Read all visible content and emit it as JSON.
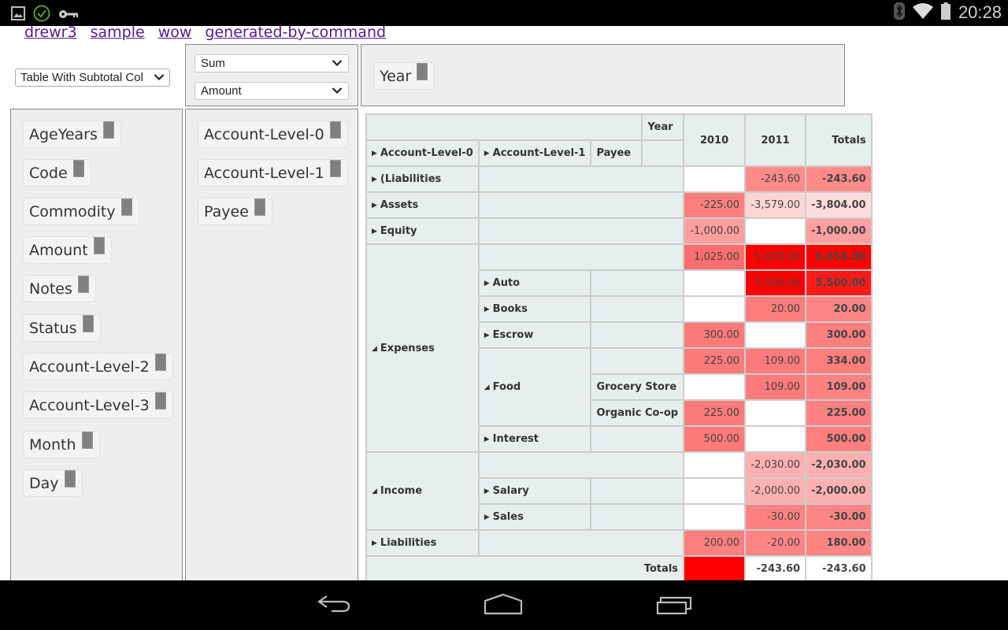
{
  "status_bar": {
    "left_icons": [
      "gallery-icon",
      "check-circle-icon",
      "key-icon"
    ],
    "right_icons": [
      "bluetooth-icon",
      "wifi-icon",
      "battery-icon"
    ],
    "time": "20:28"
  },
  "nav_links": [
    "drewr3",
    "sample",
    "wow",
    "generated-by-command"
  ],
  "renderer": {
    "selected": "Table With Subtotal Col"
  },
  "aggregator": {
    "function": "Sum",
    "attribute": "Amount"
  },
  "col_attrs": [
    "Year"
  ],
  "unused_attrs": [
    "AgeYears",
    "Code",
    "Commodity",
    "Amount",
    "Notes",
    "Status",
    "Account-Level-2",
    "Account-Level-3",
    "Month",
    "Day"
  ],
  "row_attrs": [
    "Account-Level-0",
    "Account-Level-1",
    "Payee"
  ],
  "table": {
    "col_attr_label": "Year",
    "row_headers": [
      "Account-Level-0",
      "Account-Level-1",
      "Payee"
    ],
    "col_keys": [
      "2010",
      "2011"
    ],
    "totals_label": "Totals",
    "rows": [
      {
        "l0": "(Liabilities",
        "l0_state": "collapsed",
        "l1": "",
        "payee": "",
        "v2010": "",
        "v2011": "-243.60",
        "total": "-243.60",
        "c2010": "#ffffff",
        "c2011": "#ff8a8a",
        "ctot": "#ff8a8a"
      },
      {
        "l0": "Assets",
        "l0_state": "collapsed",
        "l1": "",
        "payee": "",
        "v2010": "-225.00",
        "v2011": "-3,579.00",
        "total": "-3,804.00",
        "c2010": "#ff7f7f",
        "c2011": "#ffd6d6",
        "ctot": "#ffdcdc"
      },
      {
        "l0": "Equity",
        "l0_state": "collapsed",
        "l1": "",
        "payee": "",
        "v2010": "-1,000.00",
        "v2011": "",
        "total": "-1,000.00",
        "c2010": "#ff9e9e",
        "c2011": "#ffffff",
        "ctot": "#ffa0a0"
      },
      {
        "l0": "Expenses",
        "l0_state": "expanded",
        "l1": "",
        "payee": "",
        "v2010": "1,025.00",
        "v2011": "5,629.00",
        "total": "6,654.00",
        "c2010": "#ff6e6e",
        "c2011": "#ff0000",
        "ctot": "#ff0000"
      },
      {
        "l0": "Expenses",
        "l1": "Auto",
        "l1_state": "collapsed",
        "payee": "",
        "v2010": "",
        "v2011": "5,500.00",
        "total": "5,500.00",
        "c2010": "#ffffff",
        "c2011": "#ff0000",
        "ctot": "#ff1a1a"
      },
      {
        "l0": "Expenses",
        "l1": "Books",
        "l1_state": "collapsed",
        "payee": "",
        "v2010": "",
        "v2011": "20.00",
        "total": "20.00",
        "c2010": "#ffffff",
        "c2011": "#ff7c7c",
        "ctot": "#ff8585"
      },
      {
        "l0": "Expenses",
        "l1": "Escrow",
        "l1_state": "collapsed",
        "payee": "",
        "v2010": "300.00",
        "v2011": "",
        "total": "300.00",
        "c2010": "#ff7a7a",
        "c2011": "#ffffff",
        "ctot": "#ff7f7f"
      },
      {
        "l0": "Expenses",
        "l1": "Food",
        "l1_state": "expanded",
        "payee": "",
        "v2010": "225.00",
        "v2011": "109.00",
        "total": "334.00",
        "c2010": "#ff7a7a",
        "c2011": "#ff7a7a",
        "ctot": "#ff7e7e"
      },
      {
        "l0": "Expenses",
        "l1": "Food",
        "payee": "Grocery Store",
        "v2010": "",
        "v2011": "109.00",
        "total": "109.00",
        "c2010": "#ffffff",
        "c2011": "#ff7a7a",
        "ctot": "#ff8282"
      },
      {
        "l0": "Expenses",
        "l1": "Food",
        "payee": "Organic Co-op",
        "v2010": "225.00",
        "v2011": "",
        "total": "225.00",
        "c2010": "#ff7a7a",
        "c2011": "#ffffff",
        "ctot": "#ff8080"
      },
      {
        "l0": "Expenses",
        "l1": "Interest",
        "l1_state": "collapsed",
        "payee": "",
        "v2010": "500.00",
        "v2011": "",
        "total": "500.00",
        "c2010": "#ff7a7a",
        "c2011": "#ffffff",
        "ctot": "#ff7e7e"
      },
      {
        "l0": "Income",
        "l0_state": "expanded",
        "l1": "",
        "payee": "",
        "v2010": "",
        "v2011": "-2,030.00",
        "total": "-2,030.00",
        "c2010": "#ffffff",
        "c2011": "#ffb0b0",
        "ctot": "#ffb0b0"
      },
      {
        "l0": "Income",
        "l1": "Salary",
        "l1_state": "collapsed",
        "payee": "",
        "v2010": "",
        "v2011": "-2,000.00",
        "total": "-2,000.00",
        "c2010": "#ffffff",
        "c2011": "#ffb0b0",
        "ctot": "#ffb0b0"
      },
      {
        "l0": "Income",
        "l1": "Sales",
        "l1_state": "collapsed",
        "payee": "",
        "v2010": "",
        "v2011": "-30.00",
        "total": "-30.00",
        "c2010": "#ffffff",
        "c2011": "#ff8282",
        "ctot": "#ff8585"
      },
      {
        "l0": "Liabilities",
        "l0_state": "collapsed",
        "l1": "",
        "payee": "",
        "v2010": "200.00",
        "v2011": "-20.00",
        "total": "180.00",
        "c2010": "#ff7e7e",
        "c2011": "#ff8585",
        "ctot": "#ff8585"
      }
    ],
    "totals": {
      "v2010": "",
      "v2011": "-243.60",
      "total": "-243.60",
      "c2010": "#ff0000",
      "c2011": "#ffffff",
      "ctot": "#ffffff"
    }
  }
}
